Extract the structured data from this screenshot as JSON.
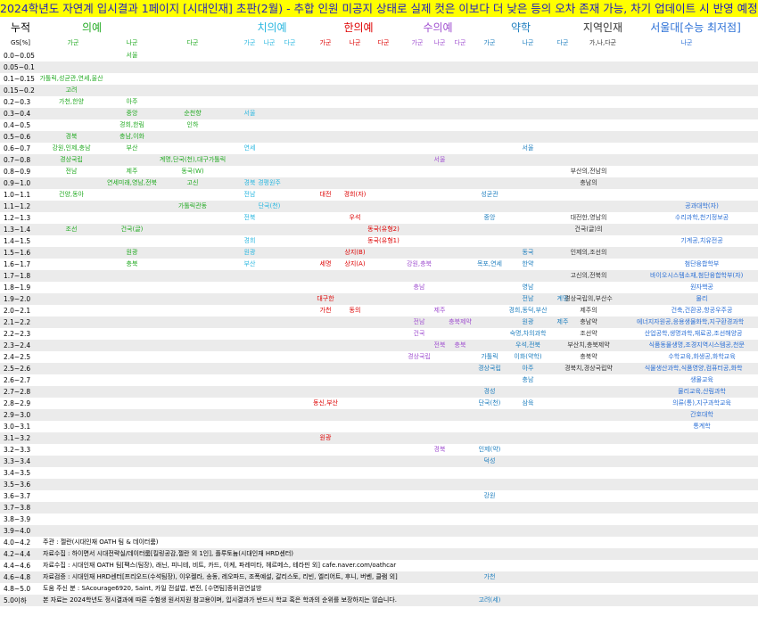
{
  "banner": "2024학년도 자연계 입시결과 1페이지 [시대인재] 초판(2월) - 추합 인원 미공지 상태로 실제 컷은 이보다 더 낮은 등의 오차 존재 가능, 차기 업데이트 시 반영 예정 / cafe.naver.com/oathcar",
  "colors": {
    "banner_bg": "#ffff00",
    "banner_text": "#1f1fbf",
    "alt_row": "#ebebeb",
    "med": "#22aa22",
    "dent": "#2ab7e0",
    "oriental": "#dd0000",
    "vet": "#a050d0",
    "pharm": "#1f7fbf",
    "regional": "#333333",
    "snu": "#2a6fd6"
  },
  "header": {
    "gs_title": "누적",
    "gs_sub": "GS[%]",
    "groups": [
      {
        "label": "의예",
        "color": "#22aa22",
        "subs": [
          "가군",
          "나군",
          "다군"
        ]
      },
      {
        "label": "치의예",
        "color": "#2ab7e0",
        "subs": [
          "가군",
          "나군",
          "다군"
        ]
      },
      {
        "label": "한의예",
        "color": "#dd0000",
        "subs": [
          "가군",
          "나군",
          "다군"
        ]
      },
      {
        "label": "수의예",
        "color": "#a050d0",
        "subs": [
          "가군",
          "나군",
          "다군"
        ]
      },
      {
        "label": "약학",
        "color": "#1f7fbf",
        "subs": [
          "가군",
          "나군",
          "다군"
        ]
      },
      {
        "label": "지역인재",
        "color": "#333333",
        "subs": [
          "가,나,다군"
        ]
      },
      {
        "label": "서울대[수능 최저점]",
        "color": "#2a6fd6",
        "subs": [
          "나군"
        ]
      }
    ]
  },
  "rows": [
    {
      "gs": "0.0~0.05",
      "cells": [
        [
          "med_b",
          "서울"
        ]
      ]
    },
    {
      "gs": "0.05~0.1",
      "cells": []
    },
    {
      "gs": "0.1~0.15",
      "cells": [
        [
          "med_a",
          "가톨릭,성균관,연세,울산"
        ]
      ]
    },
    {
      "gs": "0.15~0.2",
      "cells": [
        [
          "med_a",
          "고려"
        ]
      ]
    },
    {
      "gs": "0.2~0.3",
      "cells": [
        [
          "med_a",
          "가천,한양"
        ],
        [
          "med_b",
          "아주"
        ]
      ]
    },
    {
      "gs": "0.3~0.4",
      "cells": [
        [
          "med_b",
          "중앙"
        ],
        [
          "med_c",
          "순천향"
        ],
        [
          "den_a",
          "서울"
        ]
      ]
    },
    {
      "gs": "0.4~0.5",
      "cells": [
        [
          "med_b",
          "경희,한림"
        ],
        [
          "med_c",
          "인하"
        ]
      ]
    },
    {
      "gs": "0.5~0.6",
      "cells": [
        [
          "med_a",
          "경북"
        ],
        [
          "med_b",
          "충남,이화"
        ]
      ]
    },
    {
      "gs": "0.6~0.7",
      "cells": [
        [
          "med_a",
          "강원,인제,충남"
        ],
        [
          "med_b",
          "부산"
        ],
        [
          "den_a",
          "연세"
        ],
        [
          "pha_b",
          "서울"
        ]
      ]
    },
    {
      "gs": "0.7~0.8",
      "cells": [
        [
          "med_a",
          "경상국립"
        ],
        [
          "med_c",
          "계명,단국(천),대구가톨릭"
        ],
        [
          "vet_b",
          "서울"
        ]
      ]
    },
    {
      "gs": "0.8~0.9",
      "cells": [
        [
          "med_a",
          "전남"
        ],
        [
          "med_b",
          "제주"
        ],
        [
          "med_c",
          "동국(W)"
        ],
        [
          "reg",
          "부산의,전남의"
        ]
      ]
    },
    {
      "gs": "0.9~1.0",
      "cells": [
        [
          "med_b",
          "연세미래,영남,전북"
        ],
        [
          "med_c",
          "고신"
        ],
        [
          "den_a",
          "경북"
        ],
        [
          "den_b",
          "경평원주"
        ],
        [
          "reg",
          "충남의"
        ]
      ]
    },
    {
      "gs": "1.0~1.1",
      "cells": [
        [
          "med_a",
          "건양,동아"
        ],
        [
          "den_a",
          "전남"
        ],
        [
          "ori_a",
          "대전"
        ],
        [
          "ori_b",
          "경희(자)"
        ],
        [
          "pha_a",
          "성균관"
        ]
      ]
    },
    {
      "gs": "1.1~1.2",
      "cells": [
        [
          "med_c",
          "가톨릭관동"
        ],
        [
          "den_b",
          "단국(천)"
        ],
        [
          "snu",
          "공과대학(자)"
        ]
      ]
    },
    {
      "gs": "1.2~1.3",
      "cells": [
        [
          "den_a",
          "전북"
        ],
        [
          "ori_b",
          "우석"
        ],
        [
          "pha_a",
          "중앙"
        ],
        [
          "reg",
          "대전한,영남의"
        ],
        [
          "snu",
          "수리과학,천기정보공"
        ]
      ]
    },
    {
      "gs": "1.3~1.4",
      "cells": [
        [
          "med_a",
          "조선"
        ],
        [
          "med_b",
          "건국(글)"
        ],
        [
          "ori_c",
          "동국(유형2)"
        ],
        [
          "reg",
          "건국(글)의"
        ]
      ]
    },
    {
      "gs": "1.4~1.5",
      "cells": [
        [
          "den_a",
          "경희"
        ],
        [
          "ori_c",
          "동국(유형1)"
        ],
        [
          "snu",
          "기계공,치유전공"
        ]
      ]
    },
    {
      "gs": "1.5~1.6",
      "cells": [
        [
          "med_b",
          "원광"
        ],
        [
          "den_a",
          "원광"
        ],
        [
          "ori_b",
          "상지(B)"
        ],
        [
          "pha_b",
          "동국"
        ],
        [
          "reg",
          "인제의,조선의"
        ]
      ]
    },
    {
      "gs": "1.6~1.7",
      "cells": [
        [
          "med_b",
          "충북"
        ],
        [
          "den_a",
          "부산"
        ],
        [
          "ori_a",
          "세명"
        ],
        [
          "ori_b",
          "상지(A)"
        ],
        [
          "vet_a",
          "강원,충북"
        ],
        [
          "pha_a",
          "목포,연세"
        ],
        [
          "pha_b",
          "한약"
        ],
        [
          "snu",
          "첨단융합학부"
        ]
      ]
    },
    {
      "gs": "1.7~1.8",
      "cells": [
        [
          "reg",
          "고신의,전북의"
        ],
        [
          "snu",
          "바이오시스템소재,첨단융합학부(자)"
        ]
      ]
    },
    {
      "gs": "1.8~1.9",
      "cells": [
        [
          "vet_a",
          "충남"
        ],
        [
          "pha_b",
          "영남"
        ],
        [
          "snu",
          "원자핵공"
        ]
      ]
    },
    {
      "gs": "1.9~2.0",
      "cells": [
        [
          "ori_a",
          "대구한"
        ],
        [
          "pha_b",
          "전남"
        ],
        [
          "pha_c",
          "계명"
        ],
        [
          "reg",
          "경상국립의,부산수"
        ],
        [
          "snu",
          "물리"
        ]
      ]
    },
    {
      "gs": "2.0~2.1",
      "cells": [
        [
          "ori_a",
          "가천"
        ],
        [
          "ori_b",
          "동의"
        ],
        [
          "vet_b",
          "제주"
        ],
        [
          "pha_b",
          "경희,동덕,부산"
        ],
        [
          "reg",
          "제주의"
        ],
        [
          "snu",
          "건축,건환공,항공우주공"
        ]
      ]
    },
    {
      "gs": "2.1~2.2",
      "cells": [
        [
          "vet_a",
          "전남"
        ],
        [
          "vet_c",
          "충북제약"
        ],
        [
          "pha_b",
          "원광"
        ],
        [
          "pha_c",
          "제주"
        ],
        [
          "reg",
          "충남약"
        ],
        [
          "snu",
          "에너지자원공,응용생물화학,지구환경과학"
        ]
      ]
    },
    {
      "gs": "2.2~2.3",
      "cells": [
        [
          "vet_a",
          "건국"
        ],
        [
          "pha_b",
          "숙명,차의과학"
        ],
        [
          "reg",
          "조선약"
        ],
        [
          "snu",
          "산업공학,생명과학,재료공,조선해양공"
        ]
      ]
    },
    {
      "gs": "2.3~2.4",
      "cells": [
        [
          "vet_b",
          "전북"
        ],
        [
          "vet_c",
          "충북"
        ],
        [
          "pha_b",
          "우석,전북"
        ],
        [
          "reg",
          "부산치,충북제약"
        ],
        [
          "snu",
          "식품동물생명,조경지역시스템공,천문"
        ]
      ]
    },
    {
      "gs": "2.4~2.5",
      "cells": [
        [
          "vet_a",
          "경상국립"
        ],
        [
          "pha_a",
          "가톨릭"
        ],
        [
          "pha_b",
          "이화(약학)"
        ],
        [
          "reg",
          "충북약"
        ],
        [
          "snu",
          "수학교육,화생공,화학교육"
        ]
      ]
    },
    {
      "gs": "2.5~2.6",
      "cells": [
        [
          "pha_a",
          "경상국립"
        ],
        [
          "pha_b",
          "아주"
        ],
        [
          "reg",
          "경북치,경상국립약"
        ],
        [
          "snu",
          "식물생산과학,식품영양,컴퓨터공,화학"
        ]
      ]
    },
    {
      "gs": "2.6~2.7",
      "cells": [
        [
          "pha_b",
          "충남"
        ],
        [
          "snu",
          "생물교육"
        ]
      ]
    },
    {
      "gs": "2.7~2.8",
      "cells": [
        [
          "pha_a",
          "경성"
        ],
        [
          "snu",
          "물리교육,산림과학"
        ]
      ]
    },
    {
      "gs": "2.8~2.9",
      "cells": [
        [
          "ori_a",
          "동신,부산"
        ],
        [
          "pha_a",
          "단국(천)"
        ],
        [
          "pha_b",
          "삼육"
        ],
        [
          "snu",
          "의류(통),지구과학교육"
        ]
      ]
    },
    {
      "gs": "2.9~3.0",
      "cells": [
        [
          "snu",
          "간호대학"
        ]
      ]
    },
    {
      "gs": "3.0~3.1",
      "cells": [
        [
          "snu",
          "통계학"
        ]
      ]
    },
    {
      "gs": "3.1~3.2",
      "cells": [
        [
          "ori_a",
          "원광"
        ]
      ]
    },
    {
      "gs": "3.2~3.3",
      "cells": [
        [
          "vet_b",
          "경북"
        ],
        [
          "pha_a",
          "인제(약)"
        ]
      ]
    },
    {
      "gs": "3.3~3.4",
      "cells": [
        [
          "pha_a",
          "덕성"
        ]
      ]
    },
    {
      "gs": "3.4~3.5",
      "cells": []
    },
    {
      "gs": "3.5~3.6",
      "cells": []
    },
    {
      "gs": "3.6~3.7",
      "cells": [
        [
          "pha_a",
          "강원"
        ]
      ]
    },
    {
      "gs": "3.7~3.8",
      "cells": []
    },
    {
      "gs": "3.8~3.9",
      "cells": []
    },
    {
      "gs": "3.9~4.0",
      "cells": []
    },
    {
      "gs": "4.0~4.2",
      "cells": [],
      "note": "주관 : 젤란(시대인재 OATH 팀 & 데이터룸)"
    },
    {
      "gs": "4.2~4.4",
      "cells": [],
      "note": "자료수집 : 하이면서 시대전략실/데이터룸[킬링공감,젤란 외 1인], 플루토늄(시대인재 HRD센터)"
    },
    {
      "gs": "4.4~4.6",
      "cells": [],
      "note": "자료수집 : 시대인재 OATH 팀[팩스(팀장), 래닌, 피니테, 비트, 카드, 이케, 파레미타, 헤르메스, 테라핀 외] cafe.naver.com/oathcar"
    },
    {
      "gs": "4.6~4.8",
      "cells": [
        [
          "pha_a",
          "가천"
        ]
      ],
      "note": "자료검증 : 시대인재 HRD센터[프리오드(수석팀장), 이우켈라, 송동, 레오파드, 조폭예설, 갈리스토, 리빈, 엘리어트, 후니, 버벤, 클램 외]"
    },
    {
      "gs": "4.8~5.0",
      "cells": [],
      "note": "도움 주신 분 : SAcourage6920, Saint, 카일 전설밥, 변전, [수면팀]종위권연설방"
    },
    {
      "gs": "5.0이하",
      "cells": [
        [
          "pha_a",
          "고려(세)"
        ]
      ],
      "note": "본 자료는 2024학년도 정시결과에 따른 수험생 원서지원 참고용이며, 입시결과가 반드시 학교 혹은 학과의 순위를 보장하지는 않습니다."
    }
  ]
}
